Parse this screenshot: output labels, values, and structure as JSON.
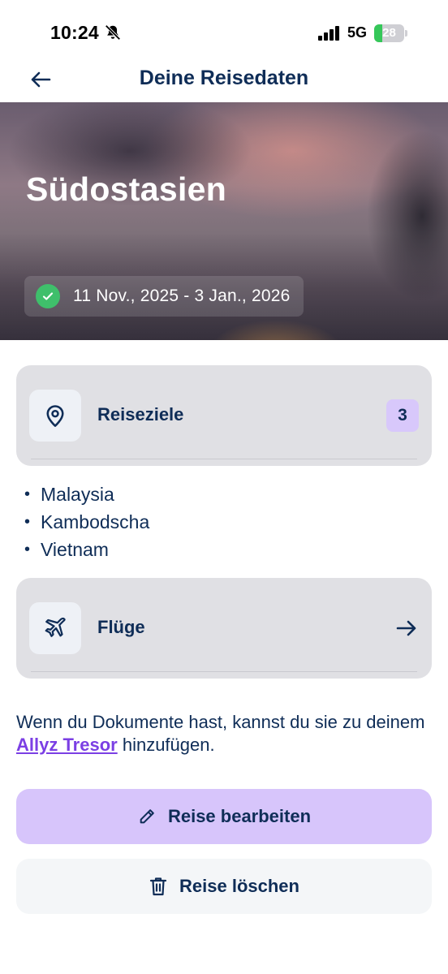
{
  "status_bar": {
    "time": "10:24",
    "network": "5G",
    "battery_level": "28",
    "battery_fraction": 0.28,
    "icons": [
      "bell-muted-icon",
      "signal-icon",
      "battery-charging-icon"
    ]
  },
  "nav": {
    "back_icon": "arrow-left-icon",
    "title": "Deine Reisedaten"
  },
  "hero": {
    "title": "Südostasien",
    "dates": "11 Nov., 2025 - 3 Jan., 2026",
    "status_icon": "check-circle-icon"
  },
  "destinations_card": {
    "icon": "map-pin-icon",
    "label": "Reiseziele",
    "count": "3"
  },
  "destinations": [
    {
      "bullet": "•",
      "name": "Malaysia"
    },
    {
      "bullet": "•",
      "name": "Kambodscha"
    },
    {
      "bullet": "•",
      "name": "Vietnam"
    }
  ],
  "flights_card": {
    "icon": "airplane-icon",
    "label": "Flüge",
    "arrow_icon": "arrow-right-icon"
  },
  "info": {
    "prefix": "Wenn du Dokumente hast, kannst du sie zu deinem ",
    "link": "Allyz Tresor",
    "suffix": " hinzufügen."
  },
  "actions": {
    "edit_label": "Reise bearbeiten",
    "edit_icon": "pencil-icon",
    "delete_label": "Reise löschen",
    "delete_icon": "trash-icon"
  },
  "colors": {
    "primary_text": "#0f2d57",
    "accent_purple": "#7b3fe4",
    "edit_button_bg": "#d7c5fb",
    "badge_bg": "#d8c8fb",
    "success_green": "#3fbf6b",
    "card_bg": "#e0e0e4"
  }
}
